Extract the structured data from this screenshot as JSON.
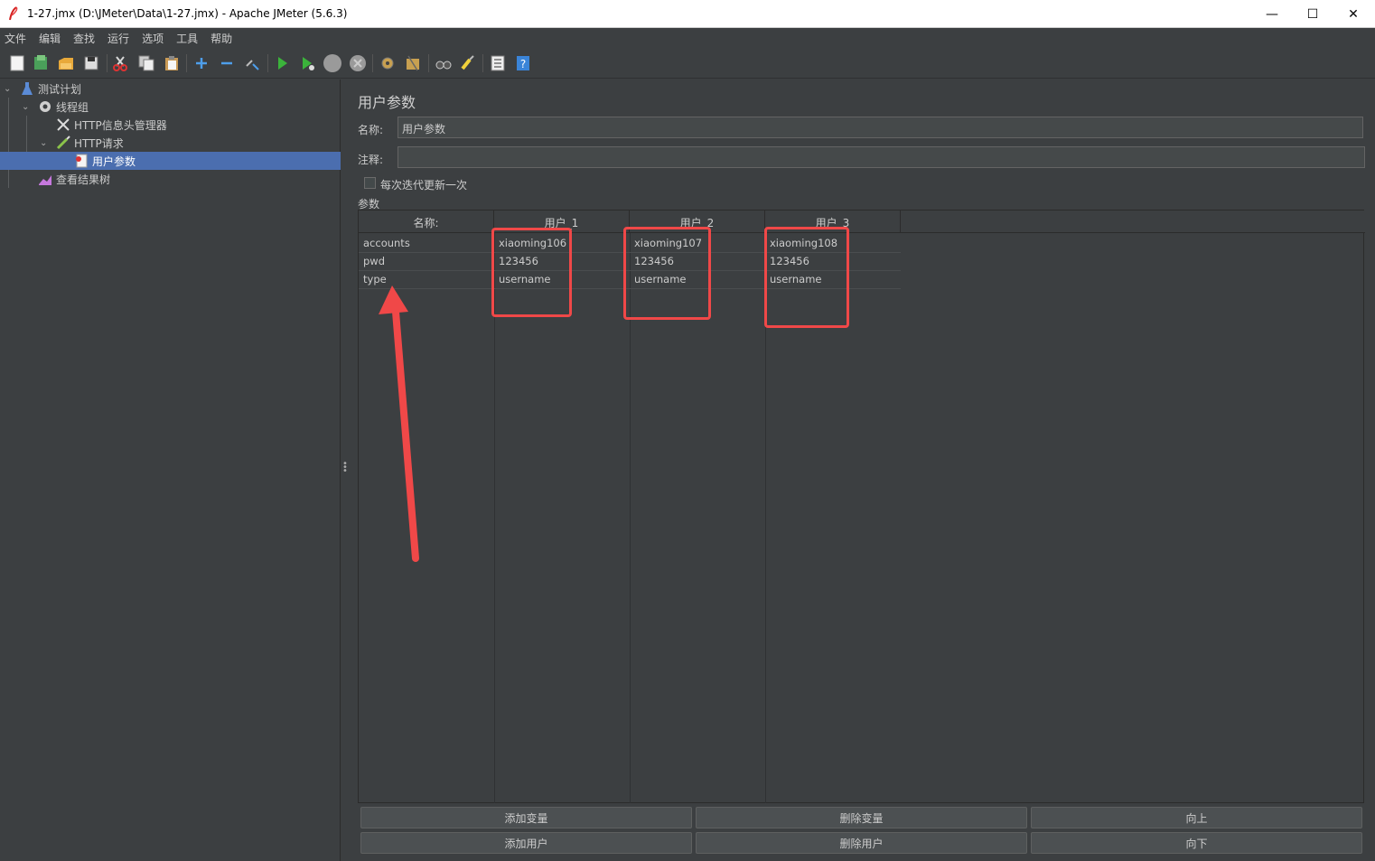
{
  "window": {
    "title": "1-27.jmx (D:\\JMeter\\Data\\1-27.jmx) - Apache JMeter (5.6.3)",
    "minimize": "—",
    "maximize": "☐",
    "close": "✕"
  },
  "menu": [
    "文件",
    "编辑",
    "查找",
    "运行",
    "选项",
    "工具",
    "帮助"
  ],
  "toolbar": {
    "icons": [
      "new-icon",
      "templates-icon",
      "open-icon",
      "save-icon",
      "cut-icon",
      "copy-icon",
      "paste-icon",
      "expand-icon",
      "collapse-icon",
      "toggle-icon",
      "start-icon",
      "start-no-pause-icon",
      "stop-icon",
      "shutdown-icon",
      "clear-icon",
      "clear-all-icon",
      "search-icon",
      "reset-search-icon",
      "function-helper-icon",
      "help-icon"
    ]
  },
  "tree": {
    "items": [
      {
        "label": "测试计划"
      },
      {
        "label": "线程组"
      },
      {
        "label": "HTTP信息头管理器"
      },
      {
        "label": "HTTP请求"
      },
      {
        "label": "用户参数"
      },
      {
        "label": "查看结果树"
      }
    ]
  },
  "panel": {
    "title": "用户参数",
    "name_label": "名称:",
    "name_value": "用户参数",
    "comment_label": "注释:",
    "comment_value": "",
    "checkbox_label": "每次迭代更新一次",
    "checkbox_checked": false,
    "params_label": "参数"
  },
  "table": {
    "headers": [
      "名称:",
      "用户_1",
      "用户_2",
      "用户_3"
    ],
    "rows": [
      {
        "name": "accounts",
        "u1": "xiaoming106",
        "u2": "xiaoming107",
        "u3": "xiaoming108"
      },
      {
        "name": "pwd",
        "u1": "123456",
        "u2": "123456",
        "u3": "123456"
      },
      {
        "name": "type",
        "u1": "username",
        "u2": "username",
        "u3": "username"
      }
    ]
  },
  "buttons": {
    "add_variable": "添加变量",
    "delete_variable": "删除变量",
    "move_up": "向上",
    "add_user": "添加用户",
    "delete_user": "删除用户",
    "move_down": "向下"
  },
  "colors": {
    "background": "#3c3f41",
    "selection": "#4b6eaf",
    "highlight": "#f04848"
  }
}
